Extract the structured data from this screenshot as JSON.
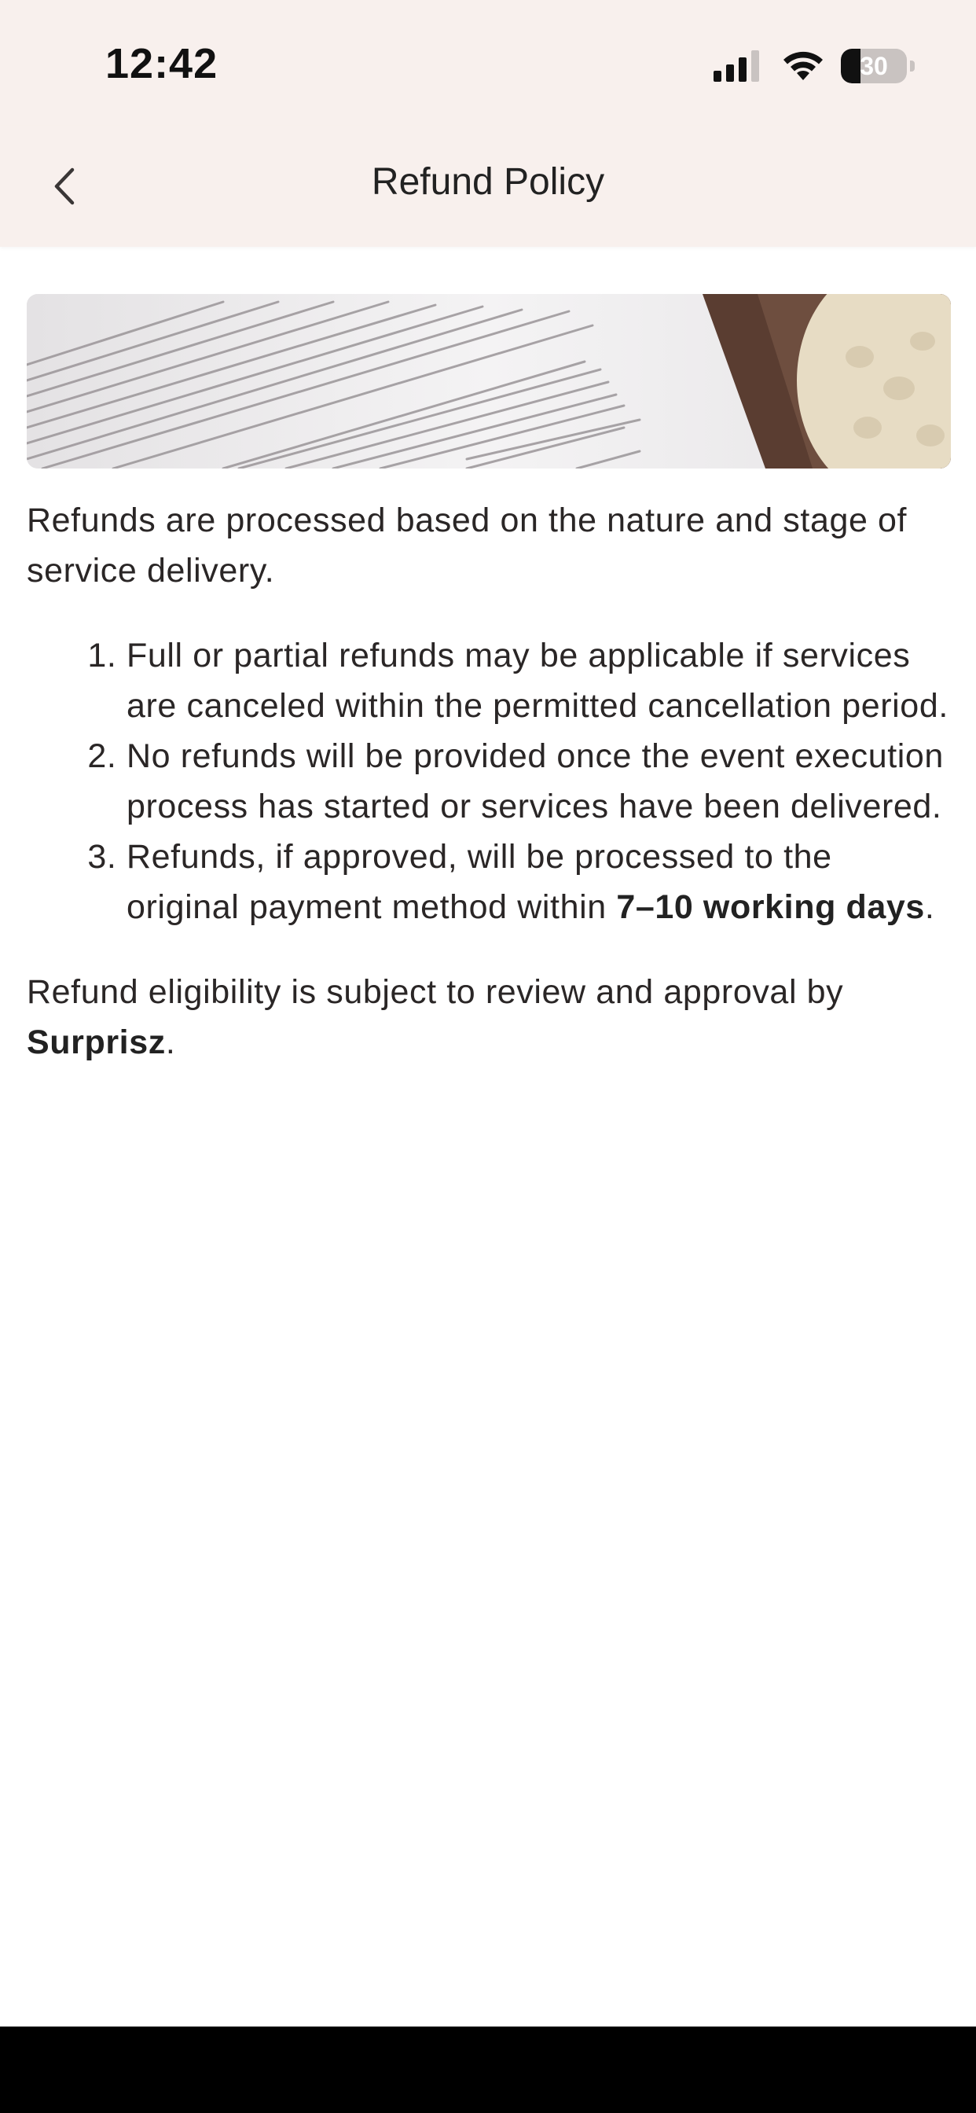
{
  "status_bar": {
    "time": "12:42",
    "battery_level": "30",
    "battery_fraction": 0.3
  },
  "header": {
    "title": "Refund Policy"
  },
  "content": {
    "intro": "Refunds are processed based on the nature and stage of service delivery.",
    "items": [
      {
        "number": "1.",
        "text": "Full or partial refunds may be applicable if services are canceled within the permitted cancellation period."
      },
      {
        "number": "2.",
        "text": "No refunds will be provided once the event execution process has started or services have been delivered."
      },
      {
        "number": "3.",
        "text_before": "Refunds, if approved, will be processed to the original payment method within ",
        "text_bold": "7–10 working days",
        "text_after": "."
      }
    ],
    "closing_before": "Refund eligibility is subject to review and approval by ",
    "closing_bold": "Surprisz",
    "closing_after": "."
  },
  "colors": {
    "header_background": "#f8f0ed",
    "text": "#2a2626",
    "home_indicator_background": "#000000"
  }
}
